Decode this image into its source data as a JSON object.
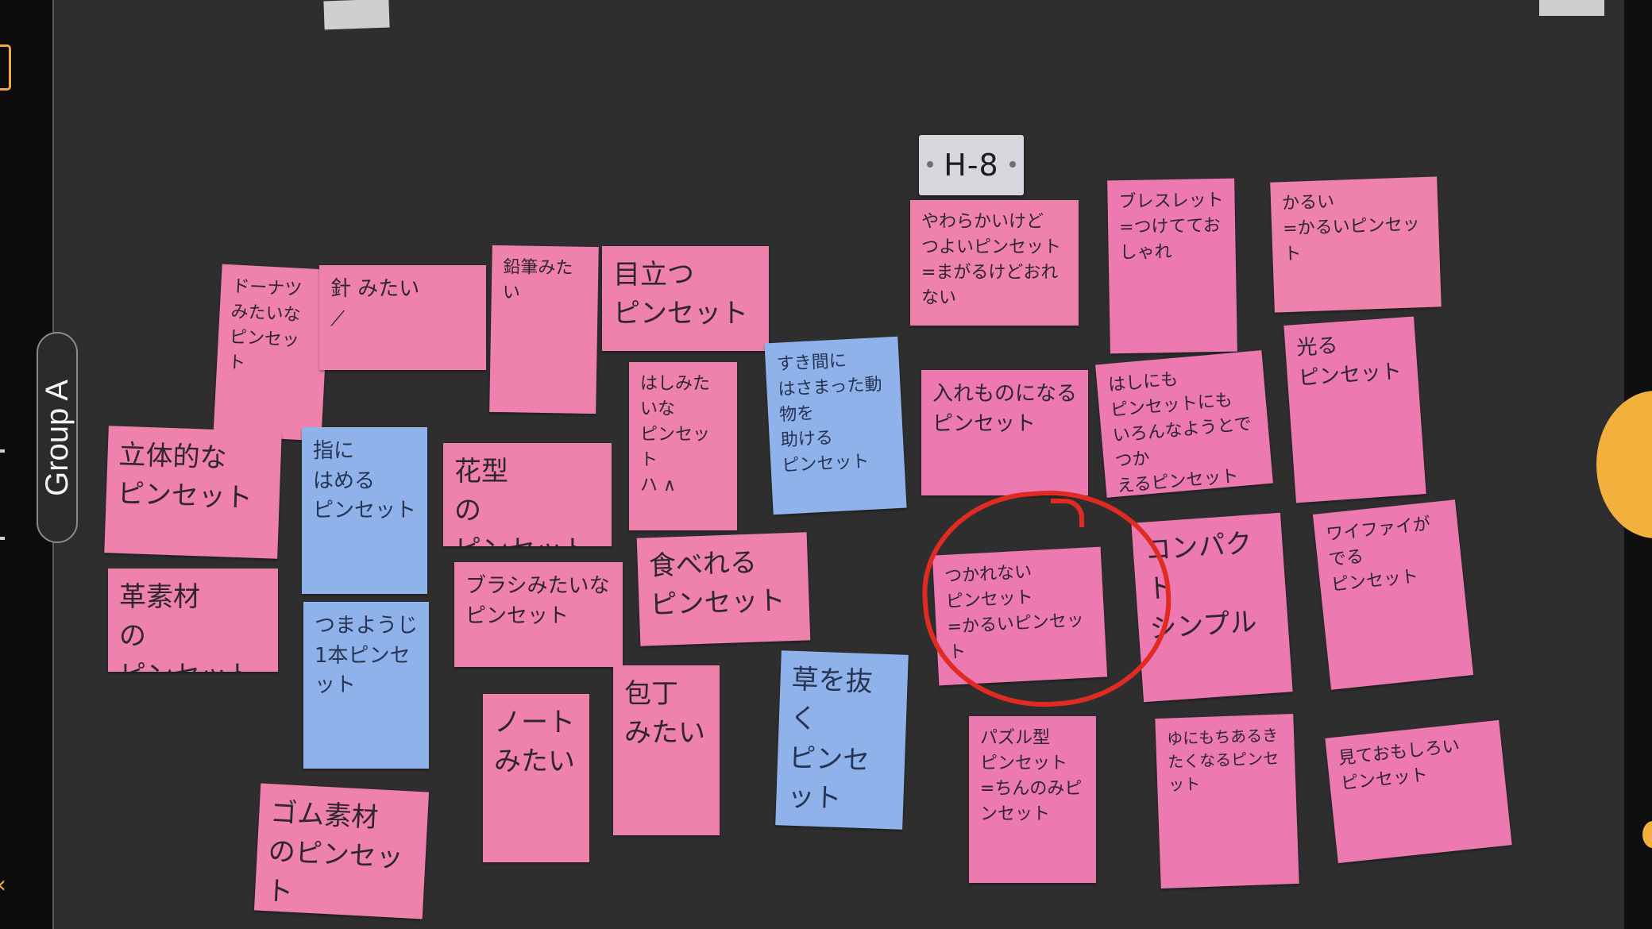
{
  "sidebar": {
    "group_label": "Group A"
  },
  "board": {
    "label": "H-8"
  },
  "notes": [
    {
      "text": "ドーナツみたいな\nピンセット"
    },
    {
      "text": "針 みたい\n⟋"
    },
    {
      "text": "鉛筆みたい"
    },
    {
      "text": "目立つ\nピンセット"
    },
    {
      "text": "やわらかいけど\nつよいピンセット\n=まがるけどおれない"
    },
    {
      "text": "ブレスレット\n=つけてておしゃれ"
    },
    {
      "text": "かるい\n=かるいピンセット"
    },
    {
      "text": "はしみたいな\nピンセット\nハ ∧"
    },
    {
      "text": "すき間に\nはさまった動物を\n助ける\nピンセット"
    },
    {
      "text": "入れものになる\nピンセット"
    },
    {
      "text": "はしにも\nピンセットにも\nいろんなようとでつか\nえるピンセット"
    },
    {
      "text": "光る\nピンセット"
    },
    {
      "text": "立体的な\nピンセット"
    },
    {
      "text": "指に\nはめる\nピンセット"
    },
    {
      "text": "花型\nの\nピンセット"
    },
    {
      "text": "食べれる\nピンセット"
    },
    {
      "text": "つかれない\nピンセット\n=かるいピンセット"
    },
    {
      "text": "コンパクト\nシンプル"
    },
    {
      "text": "ワイファイがでる\nピンセット"
    },
    {
      "text": "革素材\nの\nピンセット"
    },
    {
      "text": "ブラシみたいな\nピンセット"
    },
    {
      "text": "つまようじ\n1本ピンセット"
    },
    {
      "text": "包丁\nみたい"
    },
    {
      "text": "草を抜く\nピンセット"
    },
    {
      "text": "パズル型\nピンセット\n=ちんのみピンセット"
    },
    {
      "text": "ゆにもちあるき\nたくなるピンセット"
    },
    {
      "text": "見ておもしろい\nピンセット"
    },
    {
      "text": "ノート\nみたい"
    },
    {
      "text": "ゴム素材\nのピンセット"
    }
  ],
  "colors": {
    "pink": "#ef82ac",
    "blue": "#8fb2ea",
    "highlight": "#e02b23",
    "accent": "#f2b13d"
  }
}
